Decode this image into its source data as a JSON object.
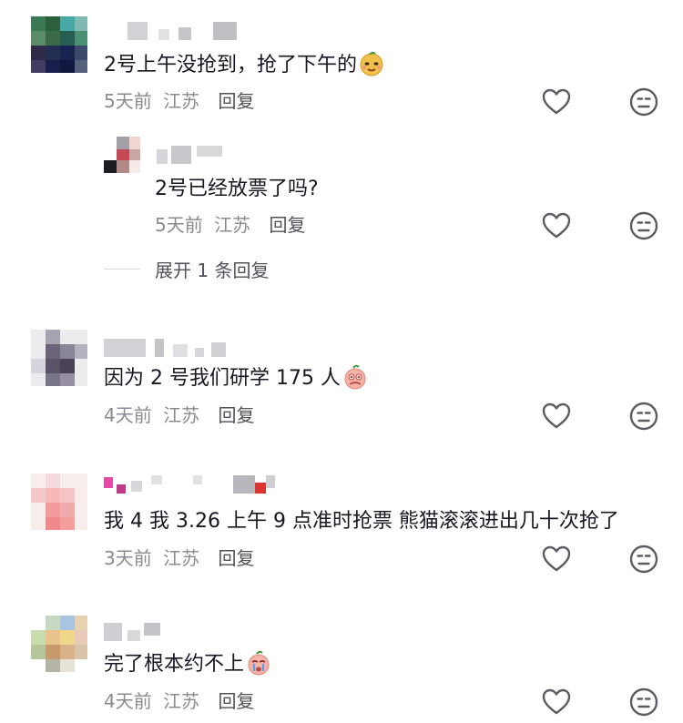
{
  "comments": [
    {
      "text": "2号上午没抢到，抢了下午的",
      "emoji": "smirk-emoji",
      "time": "5天前",
      "location": "江苏",
      "reply": "回复"
    },
    {
      "text": "2号已经放票了吗?",
      "time": "5天前",
      "location": "江苏",
      "reply": "回复"
    },
    {
      "text": "因为 2 号我们研学 175 人",
      "emoji": "crying-emoji",
      "time": "4天前",
      "location": "江苏",
      "reply": "回复"
    },
    {
      "text": "我 4 我 3.26 上午 9 点准时抢票 熊猫滚滚进出几十次抢了",
      "time": "3天前",
      "location": "江苏",
      "reply": "回复"
    },
    {
      "text": "完了根本约不上",
      "emoji": "sob-emoji",
      "time": "4天前",
      "location": "江苏",
      "reply": "回复"
    }
  ],
  "expand_replies": "展开 1 条回复",
  "icons": {
    "like": "heart-icon",
    "dislike": "meh-face-icon"
  }
}
